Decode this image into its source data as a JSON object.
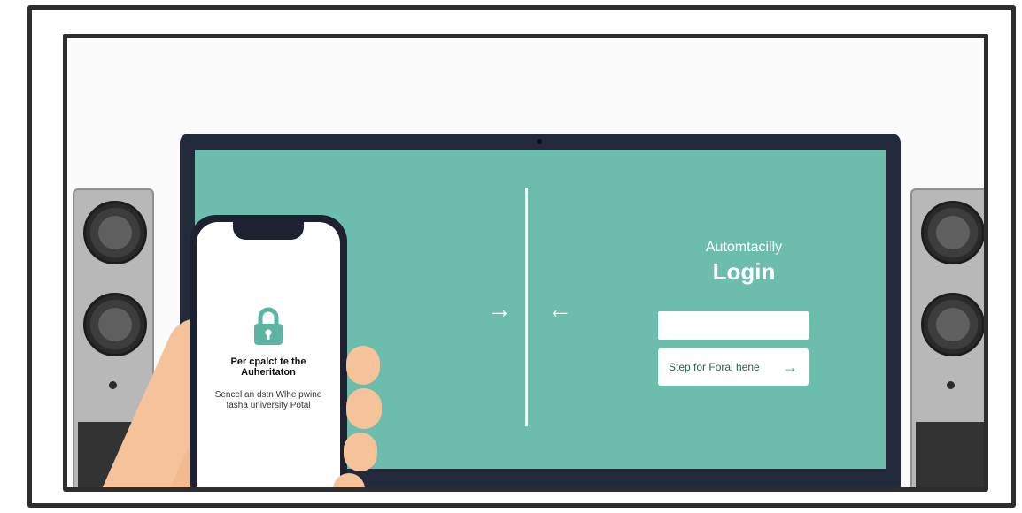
{
  "laptop_screen": {
    "login_subtitle": "Automtacilly",
    "login_title": "Login",
    "login_input_value": "",
    "login_button_label": "Step for Foral hene",
    "login_button_icon": "arrow-right-icon",
    "arrow_in_left": "→",
    "arrow_in_right": "←"
  },
  "phone_screen": {
    "icon": "lock-icon",
    "title": "Per cpalct te the Auheritaton",
    "body": "Sencel an dstn Wlhe pwine fasha university Potal"
  },
  "colors": {
    "screen_teal": "#6dbdad",
    "lock_teal": "#5cb4a3",
    "laptop_bezel": "#232a3b"
  }
}
